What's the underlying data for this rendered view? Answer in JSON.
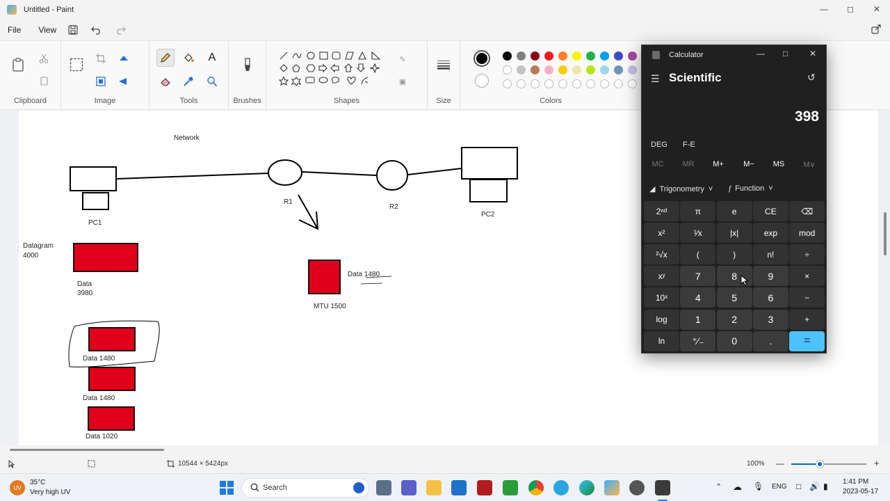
{
  "window": {
    "title": "Untitled - Paint"
  },
  "menu": {
    "file": "File",
    "view": "View"
  },
  "ribbon": {
    "groups": {
      "clipboard": "Clipboard",
      "image": "Image",
      "tools": "Tools",
      "brushes": "Brushes",
      "shapes": "Shapes",
      "size": "Size",
      "colors": "Colors"
    },
    "palette_row1": [
      "#000000",
      "#7f7f7f",
      "#880015",
      "#ed1c24",
      "#ff7f27",
      "#fff200",
      "#22b14c",
      "#00a2e8",
      "#3f48cc",
      "#a349a4"
    ],
    "palette_row2": [
      "#ffffff",
      "#c3c3c3",
      "#b97a57",
      "#ffaec9",
      "#ffc90e",
      "#efe4b0",
      "#b5e61d",
      "#99d9ea",
      "#7092be",
      "#c8bfe7"
    ]
  },
  "canvas": {
    "network_label": "Network",
    "pc1": "PC1",
    "pc2": "PC2",
    "r1": "R1",
    "r2": "R2",
    "datagram_label": "Datagram",
    "datagram_value": "4000",
    "data_3980_label": "Data",
    "data_3980_value": "3980",
    "mtu": "MTU 1500",
    "data_top": "Data 1480",
    "frag1": "Data 1480",
    "frag2": "Data 1480",
    "frag3": "Data 1020",
    "fill_color": "#e0001b"
  },
  "status": {
    "dimensions": "10544 × 5424px",
    "zoom": "100%"
  },
  "taskbar": {
    "temp": "35°C",
    "weather": "Very high UV",
    "search": "Search",
    "language": "ENG",
    "time": "1:41 PM",
    "date": "2023-05-17"
  },
  "calculator": {
    "title": "Calculator",
    "mode": "Scientific",
    "display": "398",
    "deg": "DEG",
    "fe": "F-E",
    "memory": [
      "MC",
      "MR",
      "M+",
      "M−",
      "MS",
      "M∨"
    ],
    "trig": "Trigonometry",
    "func": "Function",
    "keys": [
      [
        "2ⁿᵈ",
        "π",
        "e",
        "CE",
        "⌫"
      ],
      [
        "x²",
        "¹⁄x",
        "|x|",
        "exp",
        "mod"
      ],
      [
        "²√x",
        "(",
        ")",
        "n!",
        "÷"
      ],
      [
        "xʸ",
        "7",
        "8",
        "9",
        "×"
      ],
      [
        "10ˣ",
        "4",
        "5",
        "6",
        "−"
      ],
      [
        "log",
        "1",
        "2",
        "3",
        "+"
      ],
      [
        "ln",
        "⁺⁄₋",
        "0",
        ".",
        "="
      ]
    ]
  }
}
